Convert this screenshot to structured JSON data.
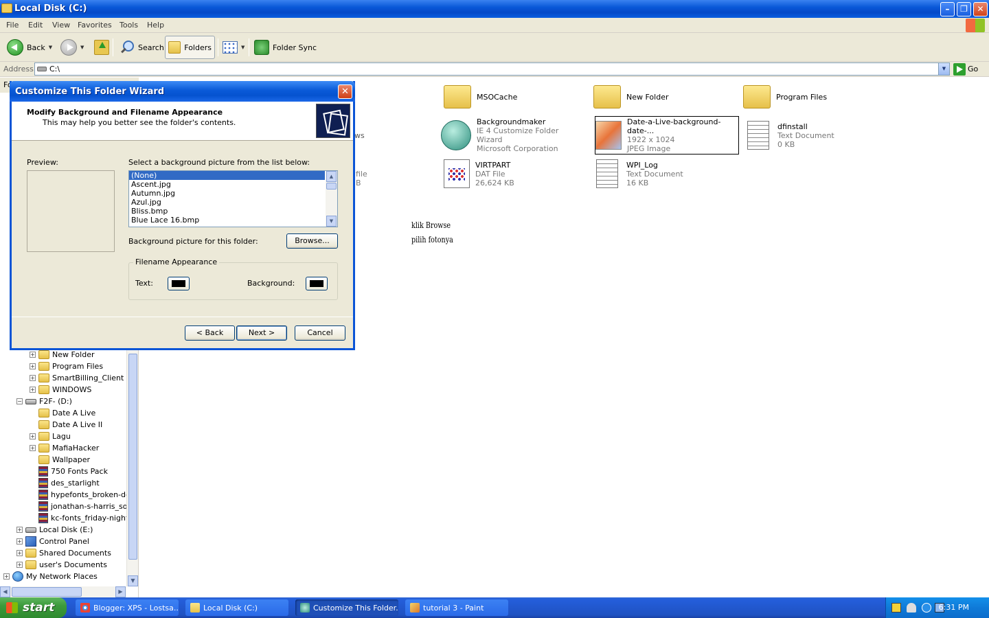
{
  "window": {
    "title": "Local Disk (C:)",
    "minimize_glyph": "–",
    "maximize_glyph": "❐",
    "close_glyph": "✕"
  },
  "menu": [
    "File",
    "Edit",
    "View",
    "Favorites",
    "Tools",
    "Help"
  ],
  "toolbar": {
    "back_label": "Back",
    "search_label": "Search",
    "folders_label": "Folders",
    "folder_sync_label": "Folder Sync"
  },
  "address": {
    "label": "Address",
    "value": "C:\\",
    "go_label": "Go"
  },
  "left_pane": {
    "header_label": "Fo",
    "tree": [
      {
        "label": "New Folder",
        "icon": "folder-icon",
        "expandable": true
      },
      {
        "label": "Program Files",
        "icon": "folder-icon",
        "expandable": true
      },
      {
        "label": "SmartBilling_Client",
        "icon": "folder-icon",
        "expandable": true
      },
      {
        "label": "WINDOWS",
        "icon": "folder-icon",
        "expandable": true
      },
      {
        "label": "F2F- (D:)",
        "icon": "drive-icon",
        "expandable": true,
        "expanded": true
      },
      {
        "label": "Date A Live",
        "icon": "folder-icon",
        "expandable": false
      },
      {
        "label": "Date A Live II",
        "icon": "folder-icon",
        "expandable": false
      },
      {
        "label": "Lagu",
        "icon": "folder-icon",
        "expandable": true
      },
      {
        "label": "MafiaHacker",
        "icon": "folder-icon",
        "expandable": true
      },
      {
        "label": "Wallpaper",
        "icon": "folder-icon",
        "expandable": false
      },
      {
        "label": "750 Fonts Pack",
        "icon": "archive-icon",
        "expandable": false
      },
      {
        "label": "des_starlight",
        "icon": "archive-icon",
        "expandable": false
      },
      {
        "label": "hypefonts_broken-de",
        "icon": "archive-icon",
        "expandable": false
      },
      {
        "label": "jonathan-s-harris_son",
        "icon": "archive-icon",
        "expandable": false
      },
      {
        "label": "kc-fonts_friday-night-",
        "icon": "archive-icon",
        "expandable": false
      },
      {
        "label": "Local Disk (E:)",
        "icon": "drive-icon",
        "expandable": true
      },
      {
        "label": "Control Panel",
        "icon": "control-panel-icon",
        "expandable": true
      },
      {
        "label": "Shared Documents",
        "icon": "folder-icon",
        "expandable": true
      },
      {
        "label": "user's Documents",
        "icon": "folder-icon",
        "expandable": true
      },
      {
        "label": "My Network Places",
        "icon": "network-icon",
        "expandable": true
      }
    ]
  },
  "files": [
    {
      "name": "MSOCache",
      "line2": "",
      "line3": "",
      "icon": "folder-icon"
    },
    {
      "name": "New Folder",
      "line2": "",
      "line3": "",
      "icon": "folder-icon"
    },
    {
      "name": "Program Files",
      "line2": "",
      "line3": "",
      "icon": "folder-icon"
    },
    {
      "name": "Backgroundmaker",
      "line2": "IE 4 Customize Folder Wizard",
      "line3": "Microsoft Corporation",
      "icon": "globe-icon"
    },
    {
      "name": "Date-a-Live-background-date-...",
      "line2": "1922 x 1024",
      "line3": "JPEG Image",
      "icon": "image-file-icon",
      "selected": true
    },
    {
      "name": "dfinstall",
      "line2": "Text Document",
      "line3": "0 KB",
      "icon": "text-document-icon"
    },
    {
      "name": "VIRTPART",
      "line2": "DAT File",
      "line3": "26,624 KB",
      "icon": "dat-file-icon"
    },
    {
      "name": "WPI_Log",
      "line2": "Text Document",
      "line3": "16 KB",
      "icon": "text-document-icon"
    }
  ],
  "partial_behind_dialog": {
    "frag1": "ws",
    "frag2": "file",
    "frag3": "B"
  },
  "annotation": {
    "line1": "klik Browse",
    "line2": "pilih fotonya"
  },
  "dialog": {
    "title": "Customize This Folder Wizard",
    "header_title": "Modify Background and Filename Appearance",
    "header_subtitle": "This may help you better see the folder's contents.",
    "preview_label": "Preview:",
    "list_label": "Select a background picture from the list below:",
    "backgrounds": [
      "(None)",
      "Ascent.jpg",
      "Autumn.jpg",
      "Azul.jpg",
      "Bliss.bmp",
      "Blue Lace 16.bmp"
    ],
    "selected_background": "(None)",
    "bg_for_folder_label": "Background picture for this folder:",
    "browse_label": "Browse...",
    "filename_group_label": "Filename Appearance",
    "text_label": "Text:",
    "background_label": "Background:",
    "text_color": "#000000",
    "background_color": "#000000",
    "back_label": "< Back",
    "next_label": "Next >",
    "cancel_label": "Cancel"
  },
  "taskbar": {
    "start_label": "start",
    "items": [
      {
        "label": "Blogger: XPS - Lostsa...",
        "icon": "chrome-icon",
        "active": false
      },
      {
        "label": "Local Disk (C:)",
        "icon": "folder-icon",
        "active": false
      },
      {
        "label": "Customize This Folder...",
        "icon": "globe-icon",
        "active": true
      },
      {
        "label": "tutorial 3 - Paint",
        "icon": "paint-icon",
        "active": false
      }
    ],
    "clock": "6:31 PM"
  },
  "colors": {
    "xp_blue": "#0a54d6",
    "selection": "#316ac5",
    "start_green": "#3c9a3c"
  }
}
